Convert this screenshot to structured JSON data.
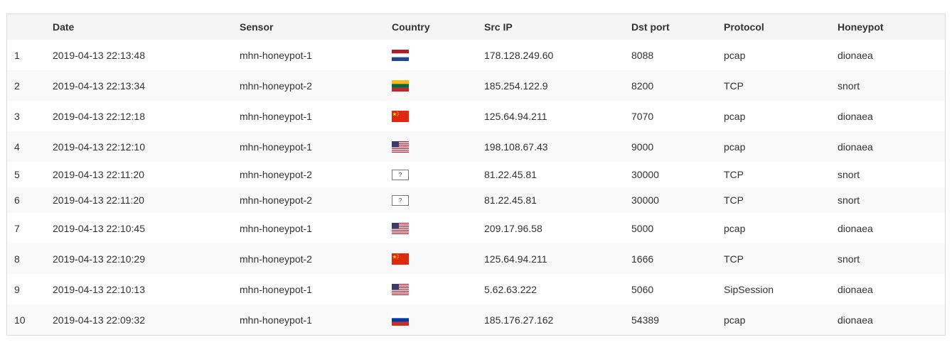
{
  "table": {
    "headers": [
      "",
      "Date",
      "Sensor",
      "Country",
      "Src IP",
      "Dst port",
      "Protocol",
      "Honeypot"
    ],
    "rows": [
      {
        "num": "1",
        "date": "2019-04-13 22:13:48",
        "sensor": "mhn-honeypot-1",
        "country": "nl-flag-icon",
        "src_ip": "178.128.249.60",
        "dst_port": "8088",
        "protocol": "pcap",
        "honeypot": "dionaea"
      },
      {
        "num": "2",
        "date": "2019-04-13 22:13:34",
        "sensor": "mhn-honeypot-2",
        "country": "lt-flag-icon",
        "src_ip": "185.254.122.9",
        "dst_port": "8200",
        "protocol": "TCP",
        "honeypot": "snort"
      },
      {
        "num": "3",
        "date": "2019-04-13 22:12:18",
        "sensor": "mhn-honeypot-1",
        "country": "cn-flag-icon",
        "src_ip": "125.64.94.211",
        "dst_port": "7070",
        "protocol": "pcap",
        "honeypot": "dionaea"
      },
      {
        "num": "4",
        "date": "2019-04-13 22:12:10",
        "sensor": "mhn-honeypot-1",
        "country": "us-flag-icon",
        "src_ip": "198.108.67.43",
        "dst_port": "9000",
        "protocol": "pcap",
        "honeypot": "dionaea"
      },
      {
        "num": "5",
        "date": "2019-04-13 22:11:20",
        "sensor": "mhn-honeypot-2",
        "country": "unknown-flag-icon",
        "country_text": "?",
        "src_ip": "81.22.45.81",
        "dst_port": "30000",
        "protocol": "TCP",
        "honeypot": "snort"
      },
      {
        "num": "6",
        "date": "2019-04-13 22:11:20",
        "sensor": "mhn-honeypot-2",
        "country": "unknown-flag-icon",
        "country_text": "?",
        "src_ip": "81.22.45.81",
        "dst_port": "30000",
        "protocol": "TCP",
        "honeypot": "snort"
      },
      {
        "num": "7",
        "date": "2019-04-13 22:10:45",
        "sensor": "mhn-honeypot-1",
        "country": "us-flag-icon",
        "src_ip": "209.17.96.58",
        "dst_port": "5000",
        "protocol": "pcap",
        "honeypot": "dionaea"
      },
      {
        "num": "8",
        "date": "2019-04-13 22:10:29",
        "sensor": "mhn-honeypot-2",
        "country": "cn-flag-icon",
        "src_ip": "125.64.94.211",
        "dst_port": "1666",
        "protocol": "TCP",
        "honeypot": "snort"
      },
      {
        "num": "9",
        "date": "2019-04-13 22:10:13",
        "sensor": "mhn-honeypot-1",
        "country": "us-flag-icon",
        "src_ip": "5.62.63.222",
        "dst_port": "5060",
        "protocol": "SipSession",
        "honeypot": "dionaea"
      },
      {
        "num": "10",
        "date": "2019-04-13 22:09:32",
        "sensor": "mhn-honeypot-1",
        "country": "ru-flag-icon",
        "src_ip": "185.176.27.162",
        "dst_port": "54389",
        "protocol": "pcap",
        "honeypot": "dionaea"
      }
    ]
  },
  "colors": {
    "header_bg": "#f5f5f5",
    "stripe_bg": "#f9f9f9",
    "border": "#dddddd",
    "text": "#333333"
  }
}
